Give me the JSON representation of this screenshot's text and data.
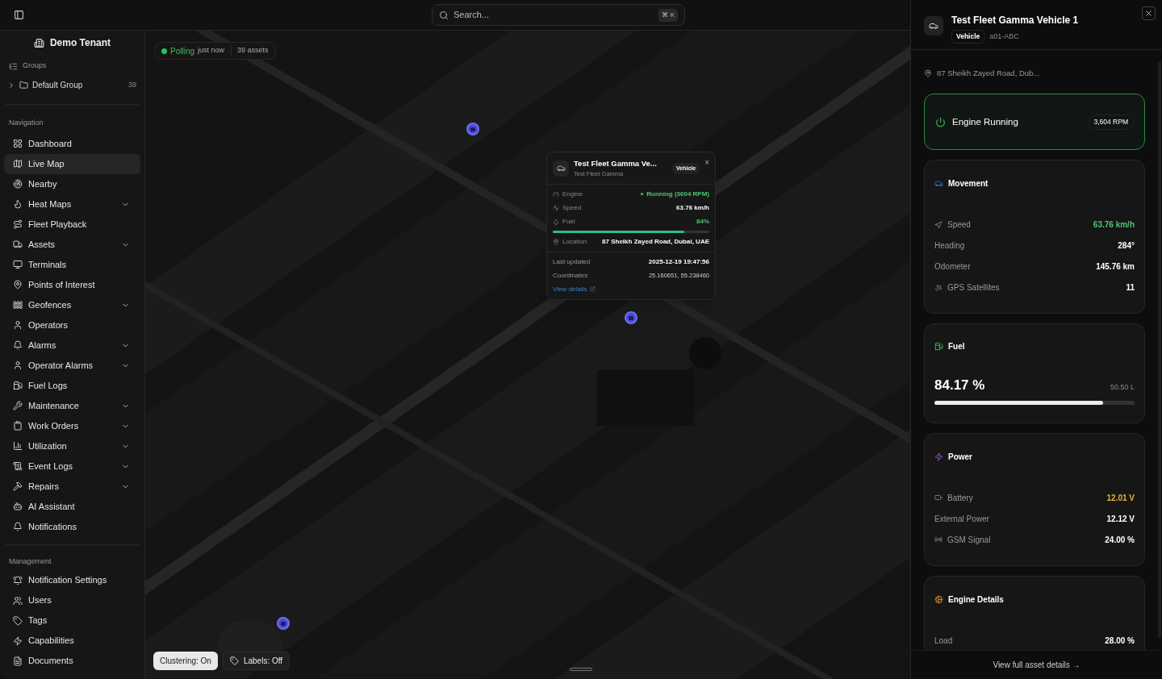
{
  "topbar": {
    "search": {
      "placeholder": "Search...",
      "shortcut": "⌘ K"
    }
  },
  "sidebar": {
    "tenant": "Demo Tenant",
    "groups_label": "Groups",
    "groups": [
      {
        "label": "Default Group",
        "count": "39",
        "expanded": false
      }
    ],
    "nav_label": "Navigation",
    "nav": [
      {
        "label": "Dashboard",
        "expandable": false,
        "selected": false
      },
      {
        "label": "Live Map",
        "expandable": false,
        "selected": true
      },
      {
        "label": "Nearby",
        "expandable": false,
        "selected": false
      },
      {
        "label": "Heat Maps",
        "expandable": true,
        "selected": false
      },
      {
        "label": "Fleet Playback",
        "expandable": false,
        "selected": false
      },
      {
        "label": "Assets",
        "expandable": true,
        "selected": false
      },
      {
        "label": "Terminals",
        "expandable": false,
        "selected": false
      },
      {
        "label": "Points of Interest",
        "expandable": false,
        "selected": false
      },
      {
        "label": "Geofences",
        "expandable": true,
        "selected": false
      },
      {
        "label": "Operators",
        "expandable": false,
        "selected": false
      },
      {
        "label": "Alarms",
        "expandable": true,
        "selected": false
      },
      {
        "label": "Operator Alarms",
        "expandable": true,
        "selected": false
      },
      {
        "label": "Fuel Logs",
        "expandable": false,
        "selected": false
      },
      {
        "label": "Maintenance",
        "expandable": true,
        "selected": false
      },
      {
        "label": "Work Orders",
        "expandable": true,
        "selected": false
      },
      {
        "label": "Utilization",
        "expandable": true,
        "selected": false
      },
      {
        "label": "Event Logs",
        "expandable": true,
        "selected": false
      },
      {
        "label": "Repairs",
        "expandable": true,
        "selected": false
      },
      {
        "label": "AI Assistant",
        "expandable": false,
        "selected": false
      },
      {
        "label": "Notifications",
        "expandable": false,
        "selected": false
      }
    ],
    "management_label": "Management",
    "management": [
      {
        "label": "Notification Settings",
        "selected": false
      },
      {
        "label": "Users",
        "selected": false
      },
      {
        "label": "Tags",
        "selected": false
      },
      {
        "label": "Capabilities",
        "selected": false
      },
      {
        "label": "Documents",
        "selected": false
      }
    ]
  },
  "map": {
    "status": {
      "state": "Polling",
      "time": "just now",
      "assets": "39 assets"
    },
    "popup": {
      "title": "Test Fleet Gamma Ve...",
      "subtitle": "Test Fleet Gamma",
      "badge": "Vehicle",
      "close": "×",
      "rows": [
        {
          "kind": "status",
          "label": "Engine",
          "value": "Running (3604 RPM)"
        },
        {
          "kind": "plain",
          "label": "Speed",
          "value": "63.76 km/h"
        },
        {
          "kind": "meter",
          "label": "Fuel",
          "value": "84%",
          "level": 0.84
        },
        {
          "kind": "plain",
          "label": "Location",
          "value": "87 Sheikh Zayed Road, Dubai, UAE"
        }
      ],
      "details": [
        {
          "label": "Last updated",
          "value": "2025-12-19 19:47:56"
        },
        {
          "label": "Coordinates",
          "value": "25.160651, 55.238460"
        }
      ],
      "link": "View details"
    },
    "controls": [
      {
        "label": "Clustering: On",
        "selected": true
      },
      {
        "label": "Labels: Off",
        "selected": false
      }
    ]
  },
  "panel": {
    "title": "Test Fleet Gamma Vehicle 1",
    "badge": "Vehicle",
    "plate": "a01-ABC",
    "address": "87 Sheikh Zayed Road, Dub...",
    "engine": {
      "label": "Engine Running",
      "reading": "3,604 RPM",
      "on": true
    },
    "sections": [
      {
        "kind": "stats",
        "title": "Movement",
        "rows": [
          {
            "label": "Speed",
            "value": "63.76 km/h",
            "color": "#4cc76f"
          },
          {
            "label": "Heading",
            "value": "284°",
            "color": "#ffffff"
          },
          {
            "label": "Odometer",
            "value": "145.76 km",
            "color": "#ffffff"
          },
          {
            "label": "GPS Satellites",
            "value": "11",
            "color": "#ffffff"
          }
        ]
      },
      {
        "kind": "fuel",
        "title": "Fuel",
        "percent": "84.17 %",
        "volume": "50.50 L",
        "level": 0.8417
      },
      {
        "kind": "stats",
        "title": "Power",
        "rows": [
          {
            "label": "Battery",
            "value": "12.01 V",
            "color": "#e3b341"
          },
          {
            "label": "External Power",
            "value": "12.12 V",
            "color": "#ffffff"
          },
          {
            "label": "GSM Signal",
            "value": "24.00 %",
            "color": "#ffffff"
          }
        ]
      },
      {
        "kind": "stats",
        "title": "Engine Details",
        "rows": [
          {
            "label": "Load",
            "value": "28.00 %",
            "color": "#ffffff"
          }
        ]
      }
    ],
    "footer": "View full asset details →"
  }
}
